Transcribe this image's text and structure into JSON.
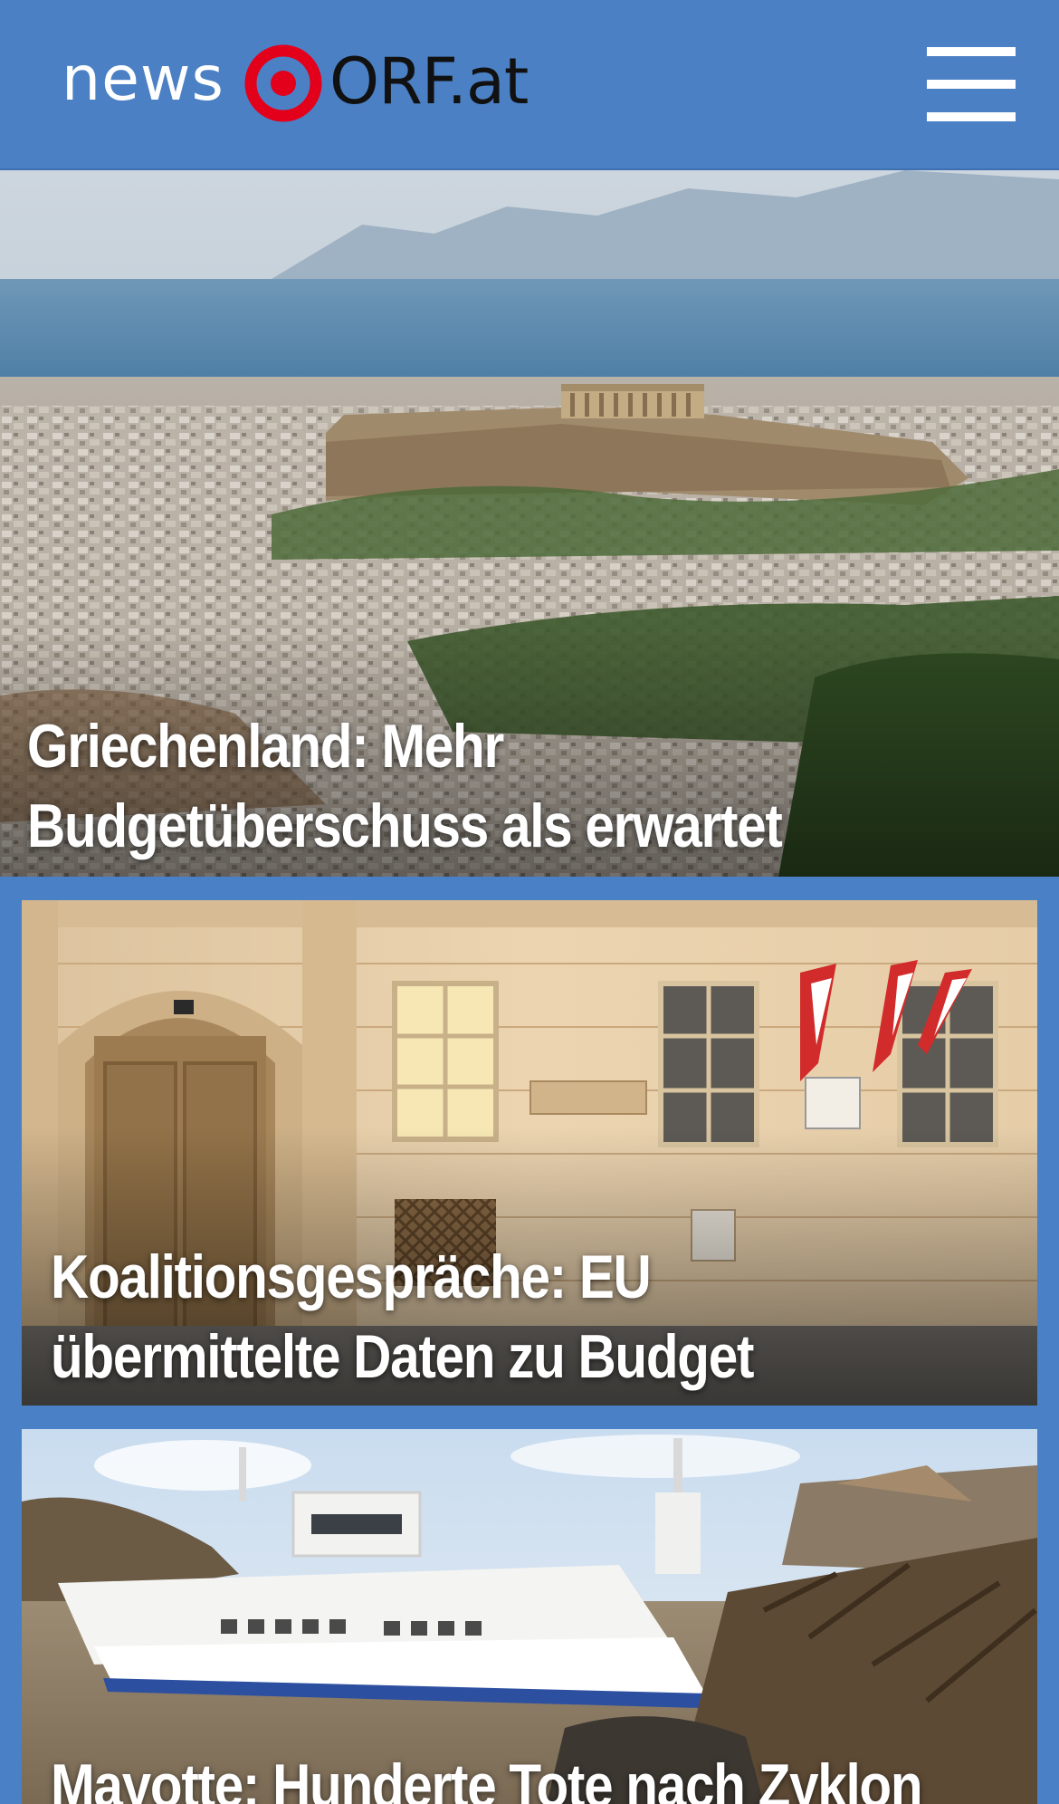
{
  "header": {
    "logo_news": "news",
    "logo_site": "ORF.at",
    "brand_red": "#e3001b",
    "bar_color": "#4b80c5"
  },
  "stories": [
    {
      "title_line1": "Griechenland: Mehr",
      "title_line2": "Budgetüberschuss als erwartet",
      "image": "athens-acropolis-cityscape"
    },
    {
      "title_line1": "Koalitionsgespräche: EU",
      "title_line2": "übermittelte Daten zu Budget",
      "image": "finance-ministry-facade-flags"
    },
    {
      "title_line1": "Mayotte: Hunderte Tote nach Zyklon",
      "image": "stranded-ferry-cyclone-damage"
    }
  ]
}
